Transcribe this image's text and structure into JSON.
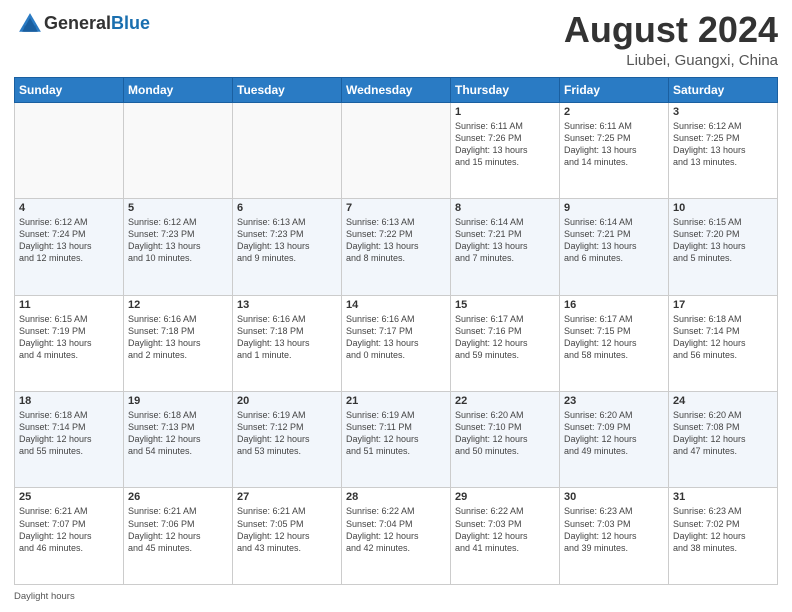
{
  "header": {
    "logo_general": "General",
    "logo_blue": "Blue",
    "month_year": "August 2024",
    "location": "Liubei, Guangxi, China"
  },
  "weekdays": [
    "Sunday",
    "Monday",
    "Tuesday",
    "Wednesday",
    "Thursday",
    "Friday",
    "Saturday"
  ],
  "footer": "Daylight hours",
  "weeks": [
    [
      {
        "day": "",
        "info": ""
      },
      {
        "day": "",
        "info": ""
      },
      {
        "day": "",
        "info": ""
      },
      {
        "day": "",
        "info": ""
      },
      {
        "day": "1",
        "info": "Sunrise: 6:11 AM\nSunset: 7:26 PM\nDaylight: 13 hours\nand 15 minutes."
      },
      {
        "day": "2",
        "info": "Sunrise: 6:11 AM\nSunset: 7:25 PM\nDaylight: 13 hours\nand 14 minutes."
      },
      {
        "day": "3",
        "info": "Sunrise: 6:12 AM\nSunset: 7:25 PM\nDaylight: 13 hours\nand 13 minutes."
      }
    ],
    [
      {
        "day": "4",
        "info": "Sunrise: 6:12 AM\nSunset: 7:24 PM\nDaylight: 13 hours\nand 12 minutes."
      },
      {
        "day": "5",
        "info": "Sunrise: 6:12 AM\nSunset: 7:23 PM\nDaylight: 13 hours\nand 10 minutes."
      },
      {
        "day": "6",
        "info": "Sunrise: 6:13 AM\nSunset: 7:23 PM\nDaylight: 13 hours\nand 9 minutes."
      },
      {
        "day": "7",
        "info": "Sunrise: 6:13 AM\nSunset: 7:22 PM\nDaylight: 13 hours\nand 8 minutes."
      },
      {
        "day": "8",
        "info": "Sunrise: 6:14 AM\nSunset: 7:21 PM\nDaylight: 13 hours\nand 7 minutes."
      },
      {
        "day": "9",
        "info": "Sunrise: 6:14 AM\nSunset: 7:21 PM\nDaylight: 13 hours\nand 6 minutes."
      },
      {
        "day": "10",
        "info": "Sunrise: 6:15 AM\nSunset: 7:20 PM\nDaylight: 13 hours\nand 5 minutes."
      }
    ],
    [
      {
        "day": "11",
        "info": "Sunrise: 6:15 AM\nSunset: 7:19 PM\nDaylight: 13 hours\nand 4 minutes."
      },
      {
        "day": "12",
        "info": "Sunrise: 6:16 AM\nSunset: 7:18 PM\nDaylight: 13 hours\nand 2 minutes."
      },
      {
        "day": "13",
        "info": "Sunrise: 6:16 AM\nSunset: 7:18 PM\nDaylight: 13 hours\nand 1 minute."
      },
      {
        "day": "14",
        "info": "Sunrise: 6:16 AM\nSunset: 7:17 PM\nDaylight: 13 hours\nand 0 minutes."
      },
      {
        "day": "15",
        "info": "Sunrise: 6:17 AM\nSunset: 7:16 PM\nDaylight: 12 hours\nand 59 minutes."
      },
      {
        "day": "16",
        "info": "Sunrise: 6:17 AM\nSunset: 7:15 PM\nDaylight: 12 hours\nand 58 minutes."
      },
      {
        "day": "17",
        "info": "Sunrise: 6:18 AM\nSunset: 7:14 PM\nDaylight: 12 hours\nand 56 minutes."
      }
    ],
    [
      {
        "day": "18",
        "info": "Sunrise: 6:18 AM\nSunset: 7:14 PM\nDaylight: 12 hours\nand 55 minutes."
      },
      {
        "day": "19",
        "info": "Sunrise: 6:18 AM\nSunset: 7:13 PM\nDaylight: 12 hours\nand 54 minutes."
      },
      {
        "day": "20",
        "info": "Sunrise: 6:19 AM\nSunset: 7:12 PM\nDaylight: 12 hours\nand 53 minutes."
      },
      {
        "day": "21",
        "info": "Sunrise: 6:19 AM\nSunset: 7:11 PM\nDaylight: 12 hours\nand 51 minutes."
      },
      {
        "day": "22",
        "info": "Sunrise: 6:20 AM\nSunset: 7:10 PM\nDaylight: 12 hours\nand 50 minutes."
      },
      {
        "day": "23",
        "info": "Sunrise: 6:20 AM\nSunset: 7:09 PM\nDaylight: 12 hours\nand 49 minutes."
      },
      {
        "day": "24",
        "info": "Sunrise: 6:20 AM\nSunset: 7:08 PM\nDaylight: 12 hours\nand 47 minutes."
      }
    ],
    [
      {
        "day": "25",
        "info": "Sunrise: 6:21 AM\nSunset: 7:07 PM\nDaylight: 12 hours\nand 46 minutes."
      },
      {
        "day": "26",
        "info": "Sunrise: 6:21 AM\nSunset: 7:06 PM\nDaylight: 12 hours\nand 45 minutes."
      },
      {
        "day": "27",
        "info": "Sunrise: 6:21 AM\nSunset: 7:05 PM\nDaylight: 12 hours\nand 43 minutes."
      },
      {
        "day": "28",
        "info": "Sunrise: 6:22 AM\nSunset: 7:04 PM\nDaylight: 12 hours\nand 42 minutes."
      },
      {
        "day": "29",
        "info": "Sunrise: 6:22 AM\nSunset: 7:03 PM\nDaylight: 12 hours\nand 41 minutes."
      },
      {
        "day": "30",
        "info": "Sunrise: 6:23 AM\nSunset: 7:03 PM\nDaylight: 12 hours\nand 39 minutes."
      },
      {
        "day": "31",
        "info": "Sunrise: 6:23 AM\nSunset: 7:02 PM\nDaylight: 12 hours\nand 38 minutes."
      }
    ]
  ]
}
